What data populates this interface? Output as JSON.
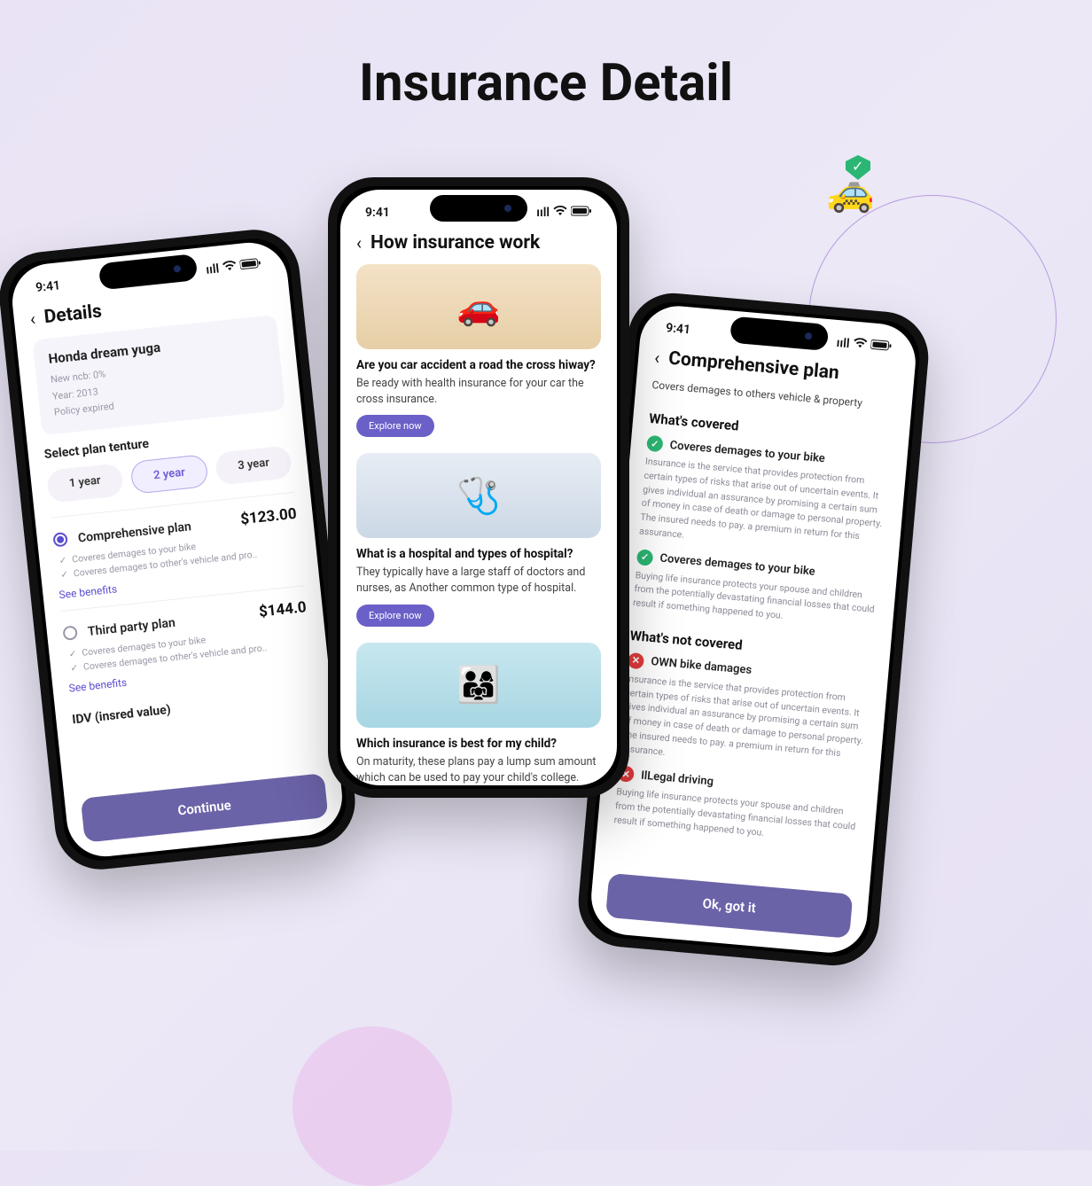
{
  "page_heading": "Insurance Detail",
  "status": {
    "time": "9:41"
  },
  "details": {
    "title": "Details",
    "vehicle": {
      "name": "Honda dream yuga",
      "ncb": "New ncb: 0%",
      "year": "Year: 2013",
      "policy": "Policy expired"
    },
    "tenure_label": "Select plan tenture",
    "tenures": [
      "1 year",
      "2 year",
      "3 year"
    ],
    "tenure_active_index": 1,
    "plans": [
      {
        "name": "Comprehensive plan",
        "price": "$123.00",
        "selected": true,
        "features": [
          "Coveres demages to your bike",
          "Coveres demages to other's vehicle and pro.."
        ],
        "see": "See benefits"
      },
      {
        "name": "Third party plan",
        "price": "$144.0",
        "selected": false,
        "features": [
          "Coveres demages to your bike",
          "Coveres demages to other's vehicle and pro.."
        ],
        "see": "See benefits"
      }
    ],
    "idv_label": "IDV (insred value)",
    "continue": "Continue"
  },
  "articles": {
    "title": "How insurance work",
    "items": [
      {
        "q": "Are you car accident a road the cross hiway?",
        "body": "Be ready with health insurance for your car the cross insurance.",
        "cta": "Explore now"
      },
      {
        "q": "What is a hospital and types of hospital?",
        "body": "They typically have a large staff of doctors and nurses, as  Another common type of hospital.",
        "cta": "Explore now"
      },
      {
        "q": "Which insurance is best for my child?",
        "body": "On maturity, these plans pay a lump sum amount which can be used to pay your child's college."
      }
    ]
  },
  "plan": {
    "title": "Comprehensive plan",
    "subtitle": "Covers demages to others vehicle & property",
    "covered_h": "What's covered",
    "covered": [
      {
        "t": "Coveres demages to your bike",
        "b": "Insurance is the service that provides protection from certain types of risks that arise out of uncertain events. It gives individual an assurance by promising a certain sum of money in case of death or damage to personal property. The insured needs to pay. a premium in return for this assurance."
      },
      {
        "t": "Coveres demages to your bike",
        "b": "Buying life insurance protects your spouse and children from the potentially devastating financial losses that could result if something happened to you."
      }
    ],
    "notcovered_h": "What's not covered",
    "notcovered": [
      {
        "t": "OWN bike damages",
        "b": "Insurance is the service that provides protection from certain types of risks that arise out of uncertain events. It gives individual an assurance by promising a certain sum of money in case of death or damage to personal property. The insured needs to pay. a premium in return for this assurance."
      },
      {
        "t": "IlLegal driving",
        "b": "Buying life insurance protects your spouse and children from the potentially devastating financial losses that could result if something happened to you."
      }
    ],
    "ok": "Ok, got it"
  }
}
